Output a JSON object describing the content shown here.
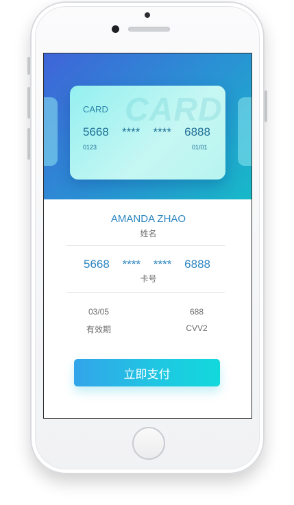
{
  "card": {
    "title": "CARD",
    "watermark": "CARD",
    "number": [
      "5668",
      "****",
      "****",
      "6888"
    ],
    "meta_left": "0123",
    "meta_right": "01/01"
  },
  "info": {
    "name": "AMANDA ZHAO",
    "name_label": "姓名",
    "number": [
      "5668",
      "****",
      "****",
      "6888"
    ],
    "number_label": "卡号",
    "expiry": "03/05",
    "expiry_label": "有效期",
    "cvv": "688",
    "cvv_label": "CVV2"
  },
  "actions": {
    "pay_label": "立即支付"
  },
  "colors": {
    "accent": "#2d86c1",
    "button_start": "#32a4ea",
    "button_end": "#12d9db"
  }
}
